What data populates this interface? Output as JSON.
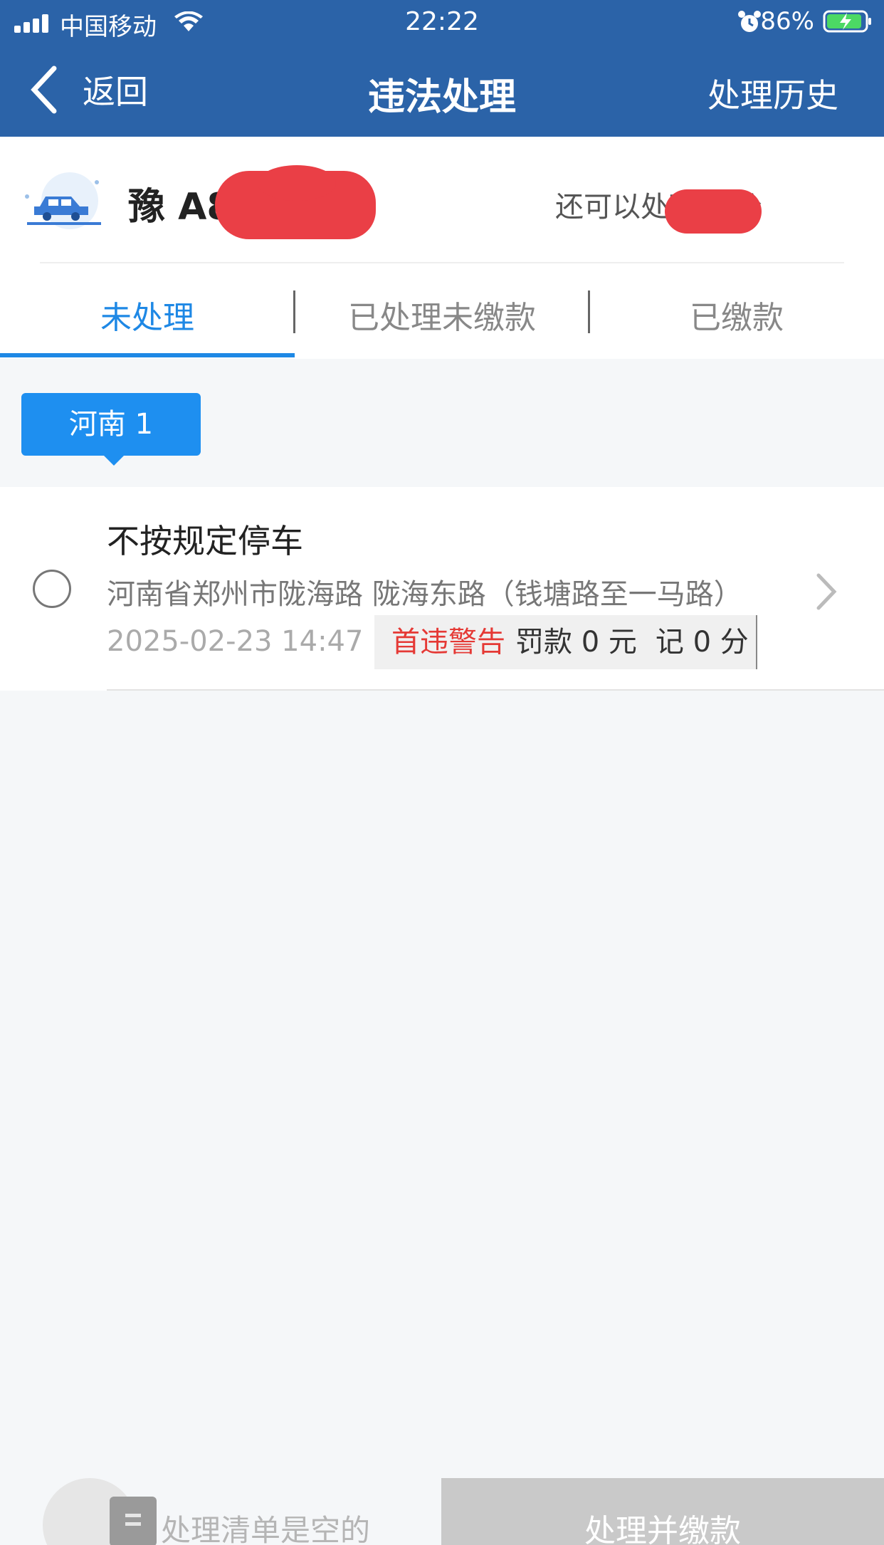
{
  "status_bar": {
    "carrier": "中国移动",
    "time": "22:22",
    "battery": "86%"
  },
  "nav": {
    "back_label": "返回",
    "title": "违法处理",
    "history_label": "处理历史"
  },
  "vehicle": {
    "plate": "豫 A8V",
    "points_text": "还可以处理",
    "points_suffix": "分"
  },
  "tabs": [
    {
      "label": "未处理",
      "active": true
    },
    {
      "label": "已处理未缴款",
      "active": false
    },
    {
      "label": "已缴款",
      "active": false
    }
  ],
  "region": {
    "label": "河南 1"
  },
  "violations": [
    {
      "title": "不按规定停车",
      "location": "河南省郑州市陇海路 陇海东路（钱塘路至一马路）",
      "time": "2025-02-23 14:47",
      "warning": "首违警告",
      "fine": "罚款 0 元",
      "points": "记 0 分"
    }
  ],
  "bottom": {
    "empty_text": "处理清单是空的",
    "pay_button": "处理并缴款"
  },
  "colors": {
    "header": "#2b63a8",
    "accent": "#1e88e5",
    "warning": "#e53935",
    "redaction": "#ea3f46"
  }
}
